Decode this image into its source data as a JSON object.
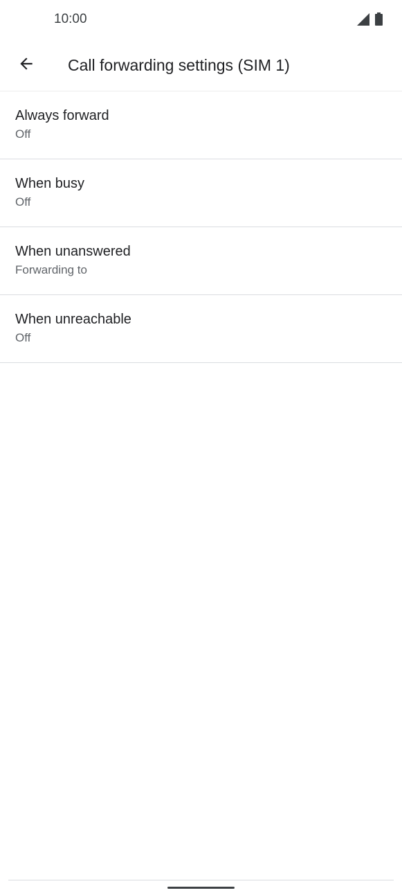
{
  "status_bar": {
    "time": "10:00",
    "icons": [
      "signal-icon",
      "battery-icon"
    ]
  },
  "app_bar": {
    "back_icon": "arrow-back-icon",
    "title": "Call forwarding settings (SIM 1)"
  },
  "items": [
    {
      "title": "Always forward",
      "summary": "Off"
    },
    {
      "title": "When busy",
      "summary": "Off"
    },
    {
      "title": "When unanswered",
      "summary": "Forwarding to"
    },
    {
      "title": "When unreachable",
      "summary": "Off"
    }
  ],
  "colors": {
    "background": "#ffffff",
    "primary_text": "#202124",
    "secondary_text": "#5f6368",
    "divider": "#dadce0"
  }
}
